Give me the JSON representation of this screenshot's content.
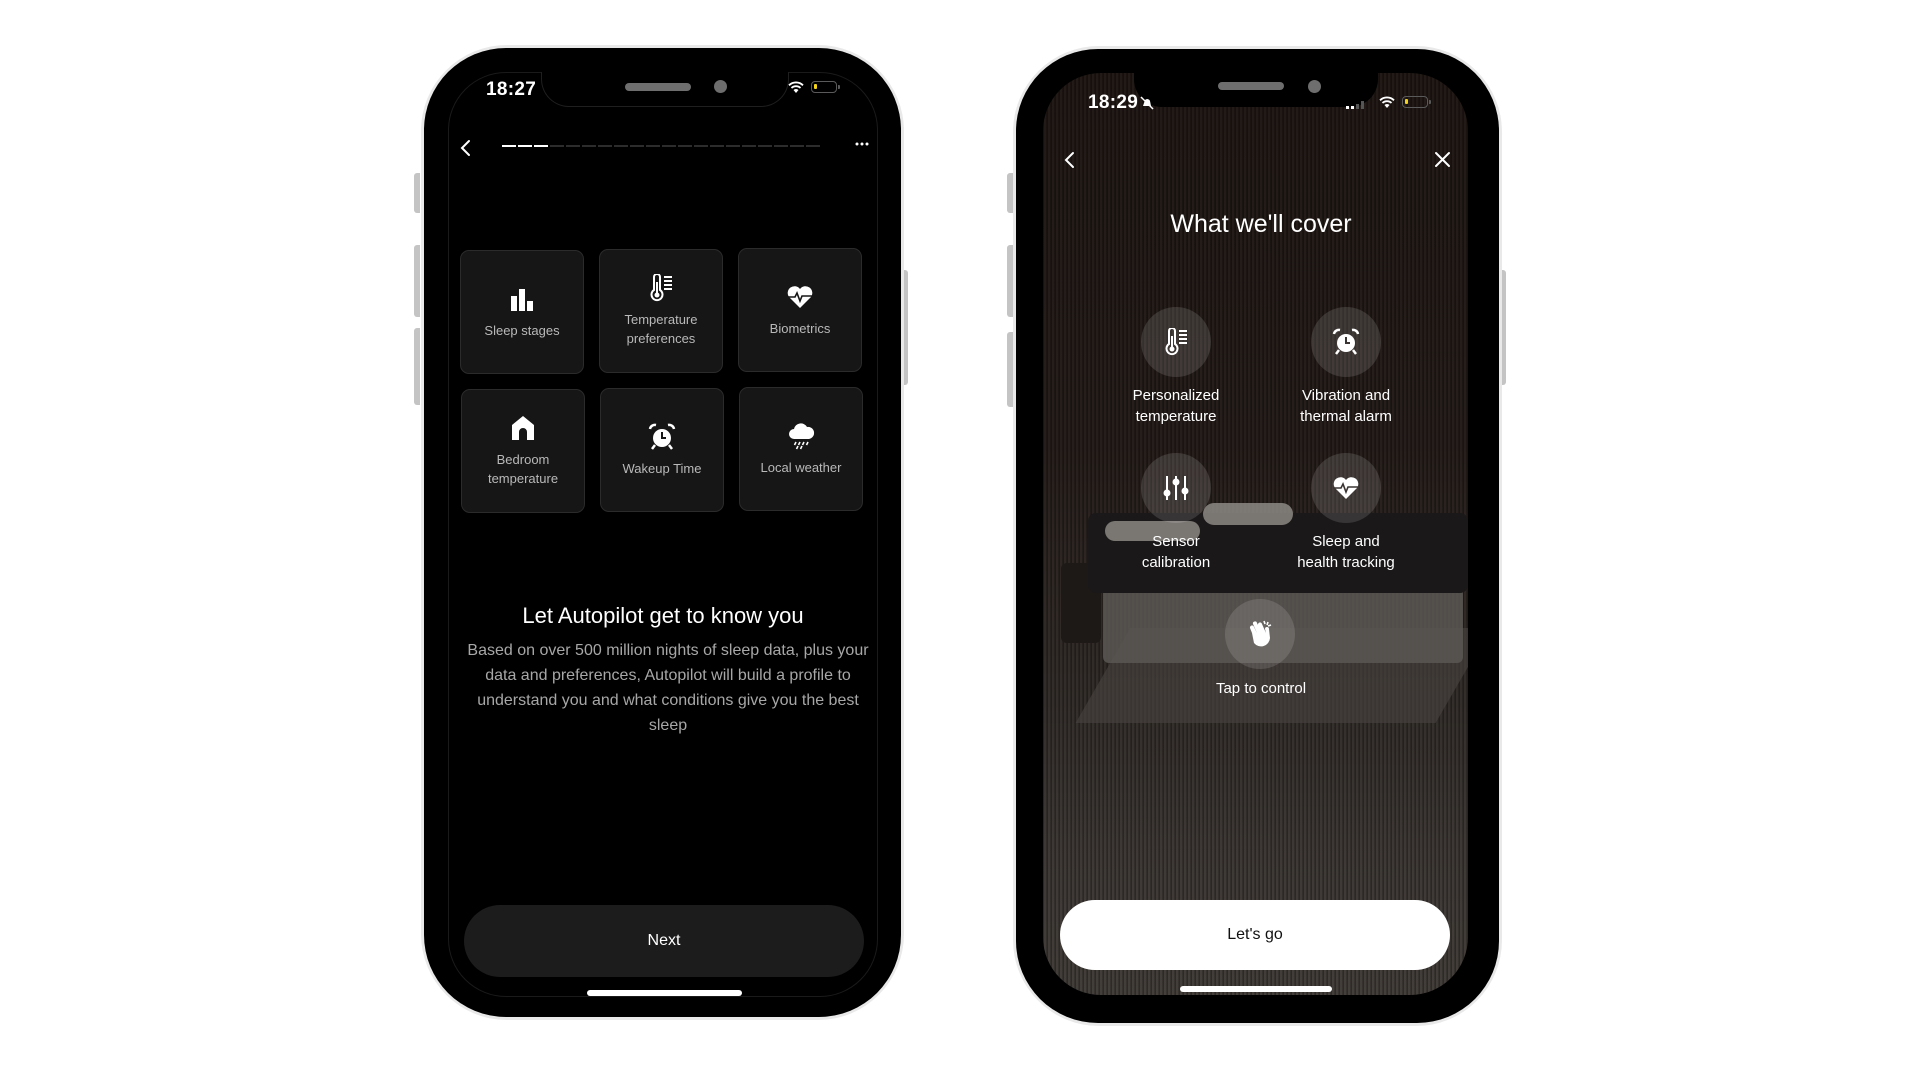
{
  "left_phone": {
    "status_bar": {
      "time": "18:27",
      "battery_color": "#f2d21b"
    },
    "nav": {
      "back_icon": "chevron-left-icon",
      "more_icon": "ellipsis-icon"
    },
    "progress": {
      "completed_steps": 3,
      "total_steps": 20
    },
    "tiles": [
      {
        "icon": "bar-chart-icon",
        "label": "Sleep stages"
      },
      {
        "icon": "thermometer-icon",
        "label": "Temperature\npreferences"
      },
      {
        "icon": "heart-pulse-icon",
        "label": "Biometrics"
      },
      {
        "icon": "home-icon",
        "label": "Bedroom\ntemperature"
      },
      {
        "icon": "alarm-clock-icon",
        "label": "Wakeup Time"
      },
      {
        "icon": "cloud-rain-icon",
        "label": "Local weather"
      }
    ],
    "title": "Let Autopilot get to know you",
    "description": "Based on over 500 million nights of sleep data, plus your data and preferences, Autopilot will build a profile to understand you and what conditions give you the best sleep",
    "next_label": "Next"
  },
  "right_phone": {
    "status_bar": {
      "time": "18:29",
      "battery_color": "#f2d21b"
    },
    "nav": {
      "back_icon": "chevron-left-icon",
      "close_icon": "close-icon"
    },
    "title": "What we'll cover",
    "features": [
      {
        "icon": "thermometer-icon",
        "label": "Personalized\ntemperature"
      },
      {
        "icon": "alarm-clock-icon",
        "label": "Vibration and\nthermal alarm"
      },
      {
        "icon": "sliders-icon",
        "label": "Sensor\ncalibration"
      },
      {
        "icon": "heart-pulse-icon",
        "label": "Sleep and\nhealth tracking"
      },
      {
        "icon": "tap-hand-icon",
        "label": "Tap to control"
      }
    ],
    "cta_label": "Let's go"
  }
}
